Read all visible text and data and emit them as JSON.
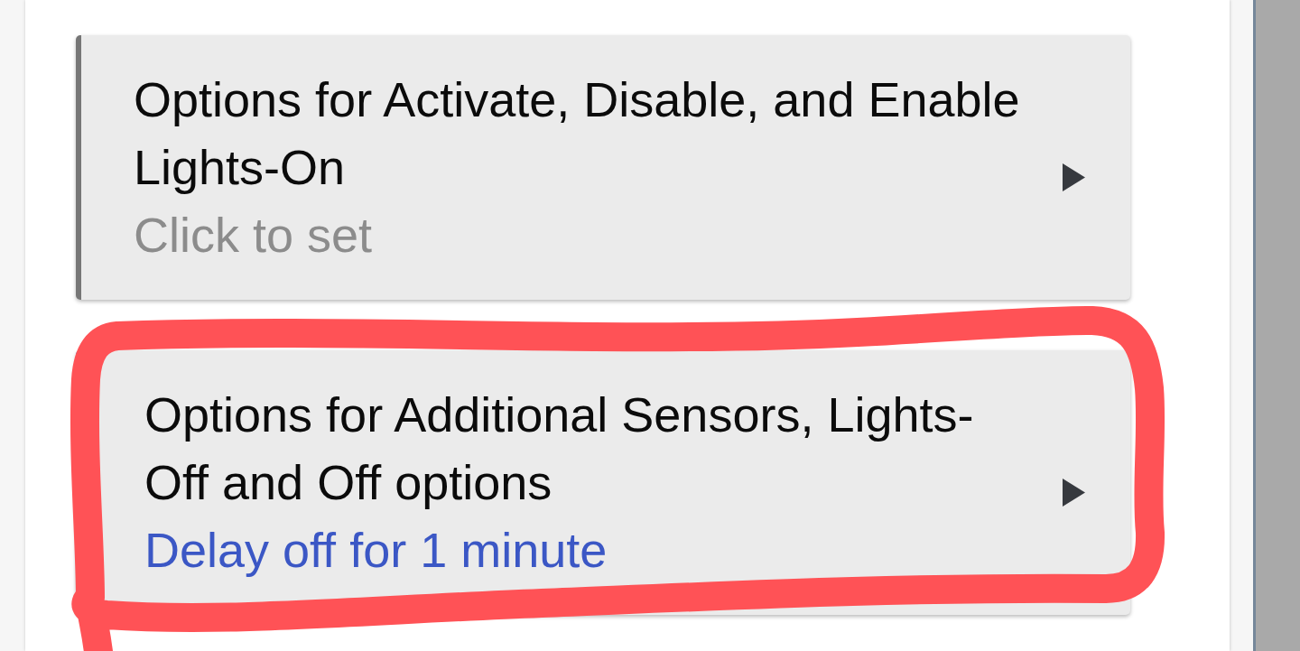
{
  "cards": [
    {
      "title": "Options for Activate, Disable, and Enable Lights-On",
      "summary": "Click to set",
      "configured": false,
      "circled": false
    },
    {
      "title": "Options for Additional Sensors, Lights-Off and Off options",
      "summary": "Delay off for 1 minute",
      "configured": true,
      "circled": true
    }
  ]
}
